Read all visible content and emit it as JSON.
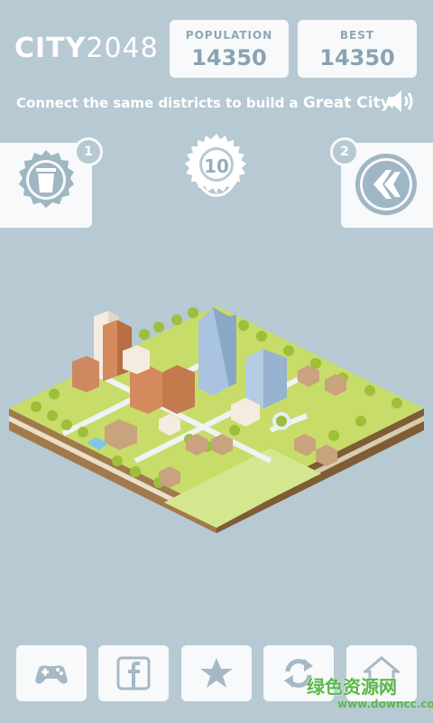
{
  "header": {
    "logo_bold": "CITY",
    "logo_num": "2048",
    "population_label": "POPULATION",
    "population_value": "14350",
    "best_label": "BEST",
    "best_value": "14350"
  },
  "instruction": {
    "prefix": "Connect the same districts to build a ",
    "emphasis": "Great City."
  },
  "powerups": {
    "left_count": "1",
    "left_icon": "trash-can-icon",
    "right_count": "2",
    "right_icon": "undo-arrow-icon"
  },
  "level": {
    "value": "10"
  },
  "bottom_bar": {
    "icons": [
      "gamepad-icon",
      "facebook-icon",
      "star-icon",
      "refresh-icon",
      "home-icon"
    ]
  },
  "watermark": {
    "text": "绿色资源网",
    "url": "www.downcc.com"
  },
  "colors": {
    "background": "#b7c9d3",
    "panel": "#f7f9fa",
    "grass": "#c8dc6a",
    "tree": "#9dbf3a",
    "road": "#e8eef0"
  }
}
